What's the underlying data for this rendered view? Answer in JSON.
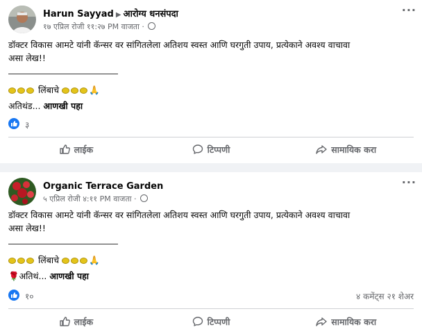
{
  "posts": [
    {
      "author": "Harun Sayyad",
      "group": "आरोग्य धनसंपदा",
      "timestamp": "१७ एप्रिल रोजी ११:२७ PM वाजता",
      "privacy_icon": "globe-icon",
      "text_line1": "डॉक्टर विकास आमटे यांनी कॅन्सर वर सांगितलेला अतिशय स्वस्त आणि घरगुती  उपाय, प्रत्येकाने अवश्य वाचावा",
      "text_line2": "असा लेख!!",
      "lemon_label": "लिंबाचे",
      "prayer_emoji": "🙏",
      "text_line4": "अतिथंड...",
      "see_more": "आणखी पहा",
      "reaction_count": "३",
      "comments_shares": ""
    },
    {
      "author": "Organic Terrace Garden",
      "timestamp": "५ एप्रिल रोजी ४:११ PM वाजता",
      "privacy_icon": "globe-icon",
      "text_line1": "डॉक्टर विकास आमटे यांनी कॅन्सर वर सांगितलेला अतिशय स्वस्त आणि घरगुती  उपाय, प्रत्येकाने अवश्य वाचावा",
      "text_line2": "असा लेख!!",
      "lemon_label": "लिंबाचे",
      "prayer_emoji": "🙏",
      "rose_emoji": "🌹",
      "text_line4": "अतिथं...",
      "see_more": "आणखी पहा",
      "reaction_count": "१०",
      "comments_shares": "४ कमेंट्स २१ शेअर"
    }
  ],
  "actions": {
    "like": "लाईक",
    "comment": "टिप्पणी",
    "share": "सामायिक करा"
  },
  "colors": {
    "like_blue": "#1877f2",
    "secondary_text": "#65676b",
    "background": "#f0f2f5"
  }
}
